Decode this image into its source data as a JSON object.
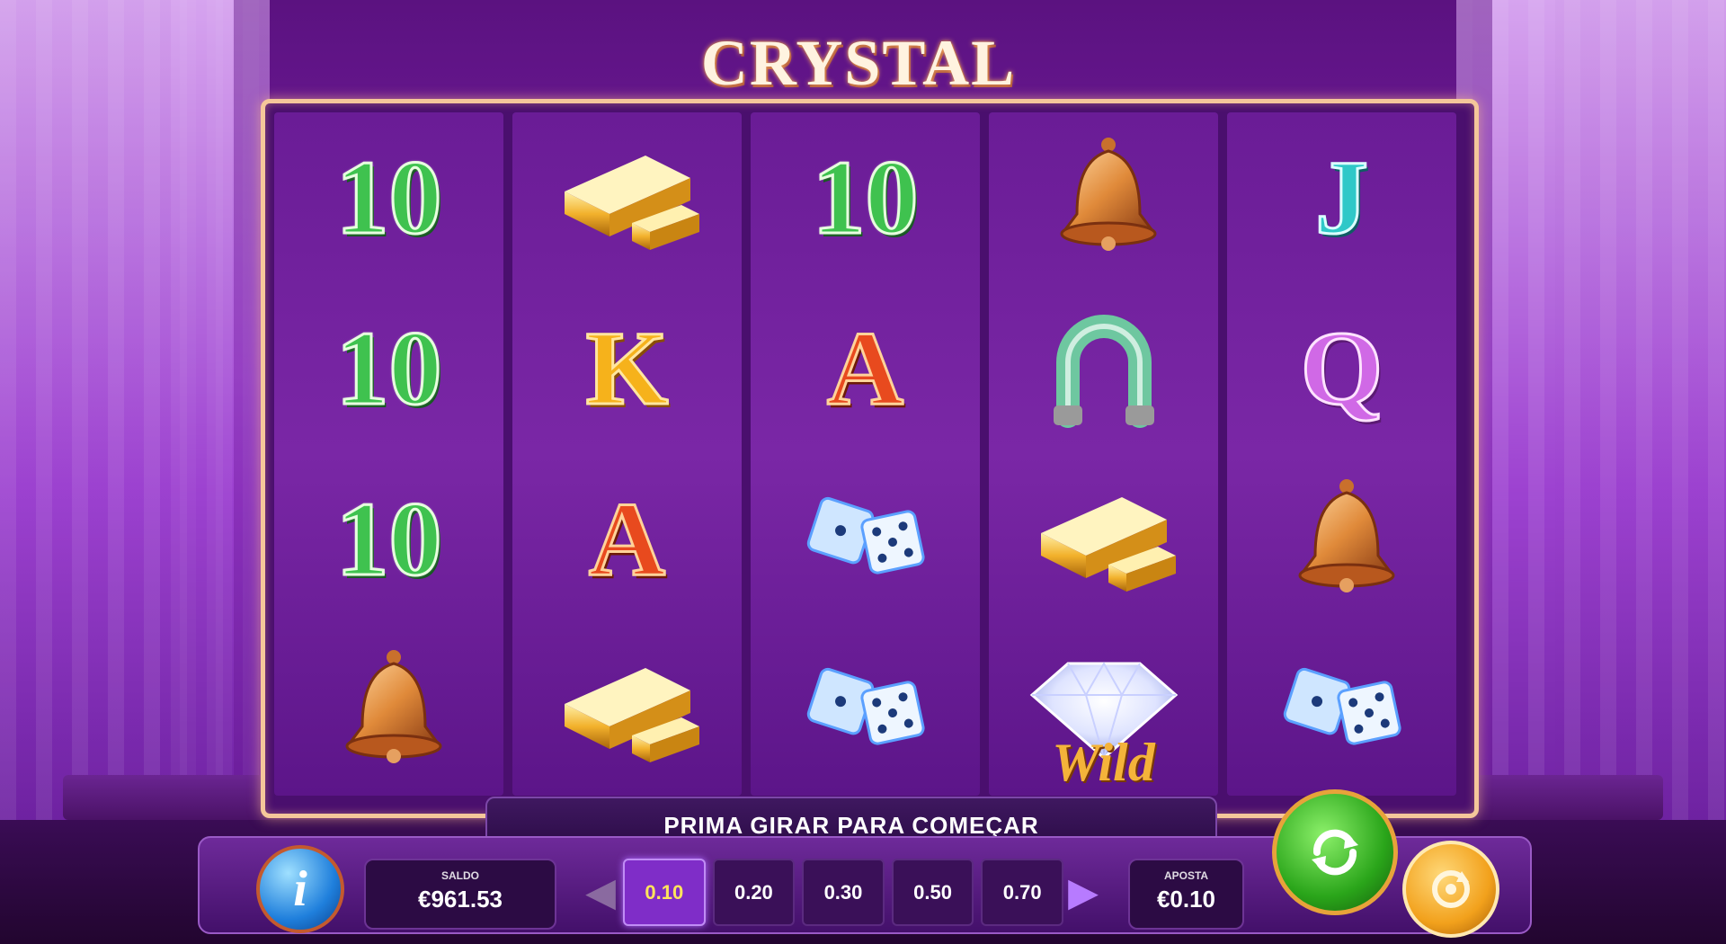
{
  "game": {
    "logo_text": "CRYSTAL",
    "message": "PRIMA GIRAR PARA COMEÇAR"
  },
  "reels": [
    [
      {
        "type": "text",
        "label": "10",
        "style": "green"
      },
      {
        "type": "text",
        "label": "10",
        "style": "green"
      },
      {
        "type": "text",
        "label": "10",
        "style": "green"
      },
      {
        "type": "icon",
        "icon": "bell-icon"
      }
    ],
    [
      {
        "type": "icon",
        "icon": "gold-bars-icon"
      },
      {
        "type": "text",
        "label": "K",
        "style": "gold"
      },
      {
        "type": "text",
        "label": "A",
        "style": "red"
      },
      {
        "type": "icon",
        "icon": "gold-bars-icon"
      }
    ],
    [
      {
        "type": "text",
        "label": "10",
        "style": "green"
      },
      {
        "type": "text",
        "label": "A",
        "style": "red"
      },
      {
        "type": "icon",
        "icon": "dice-icon"
      },
      {
        "type": "icon",
        "icon": "dice-icon"
      }
    ],
    [
      {
        "type": "icon",
        "icon": "bell-icon"
      },
      {
        "type": "icon",
        "icon": "horseshoe-icon"
      },
      {
        "type": "icon",
        "icon": "gold-bars-icon"
      },
      {
        "type": "icon",
        "icon": "diamond-wild-icon",
        "wild_label": "Wild"
      }
    ],
    [
      {
        "type": "text",
        "label": "J",
        "style": "teal"
      },
      {
        "type": "text",
        "label": "Q",
        "style": "pink"
      },
      {
        "type": "icon",
        "icon": "bell-icon"
      },
      {
        "type": "icon",
        "icon": "dice-icon"
      }
    ]
  ],
  "controls": {
    "info_label": "i",
    "balance_label": "SALDO",
    "balance_value": "€961.53",
    "credits_label": "APOSTA",
    "credits_value": "€0.10",
    "bets": [
      "0.10",
      "0.20",
      "0.30",
      "0.50",
      "0.70"
    ],
    "selected_bet_index": 0
  },
  "colors": {
    "frame": "#f5c79a",
    "background": "#7a1fa8",
    "spin": "#2aa51a",
    "auto": "#f2a11c"
  }
}
